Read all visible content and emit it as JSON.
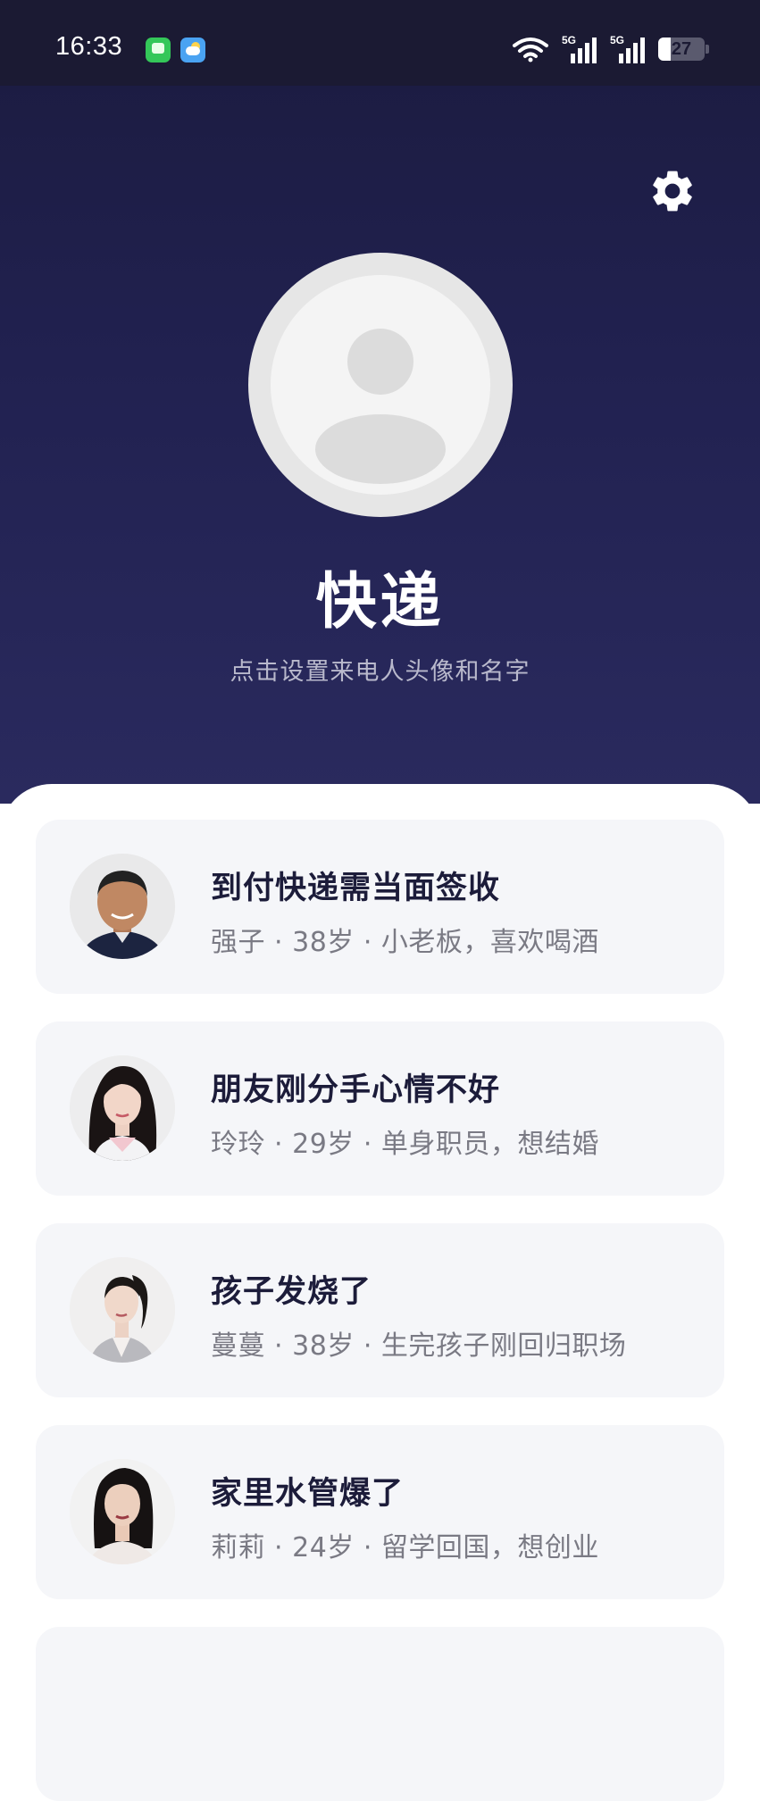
{
  "status_bar": {
    "time": "16:33",
    "battery": "27",
    "app_icons": [
      "messages-icon",
      "weather-icon"
    ],
    "signal_icons": [
      "wifi-icon",
      "5g-signal-icon",
      "5g-signal-icon",
      "battery-icon"
    ]
  },
  "header": {
    "settings_icon": "gear-icon",
    "caller_name": "快递",
    "caller_hint": "点击设置来电人头像和名字"
  },
  "scenarios": [
    {
      "title": "到付快递需当面签收",
      "desc": "强子 · 38岁 · 小老板，喜欢喝酒",
      "avatar": "man-portrait"
    },
    {
      "title": "朋友刚分手心情不好",
      "desc": "玲玲 · 29岁 · 单身职员，想结婚",
      "avatar": "woman-portrait"
    },
    {
      "title": "孩子发烧了",
      "desc": "蔓蔓 · 38岁 · 生完孩子刚回归职场",
      "avatar": "woman-portrait"
    },
    {
      "title": "家里水管爆了",
      "desc": "莉莉 · 24岁 · 留学回国，想创业",
      "avatar": "woman-portrait"
    }
  ],
  "colors": {
    "hero_top": "#1b1b3f",
    "hero_bottom": "#2a2a5e",
    "card_bg": "#f5f6f9",
    "title_text": "#1c1c3a",
    "desc_text": "#7a7a84"
  }
}
